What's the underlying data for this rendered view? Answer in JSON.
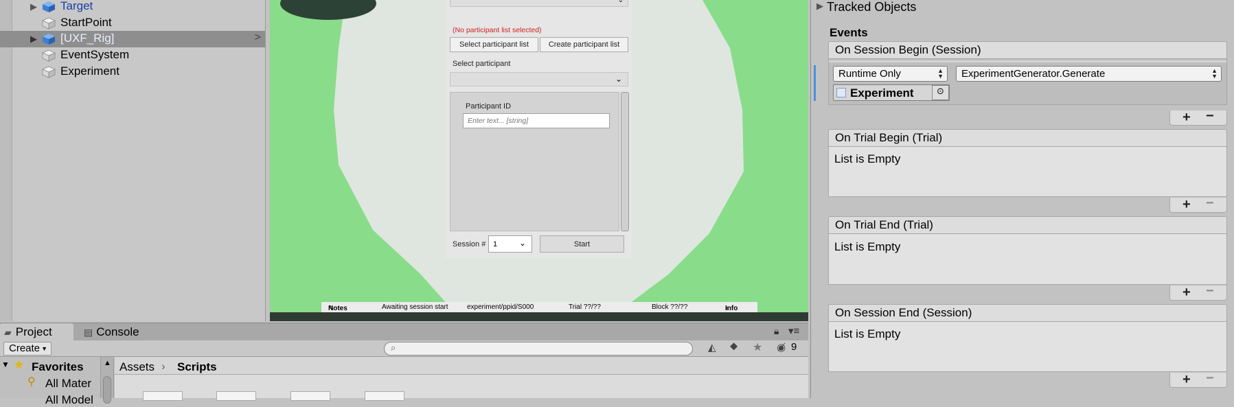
{
  "hierarchy": {
    "items": [
      {
        "label": "Target"
      },
      {
        "label": "StartPoint"
      },
      {
        "label": "[UXF_Rig]"
      },
      {
        "label": "EventSystem"
      },
      {
        "label": "Experiment"
      }
    ]
  },
  "game": {
    "no_list_warning": "(No participant list selected)",
    "select_list_button": "Select participant list",
    "create_list_button": "Create participant list",
    "select_participant_label": "Select participant",
    "participant_id_label": "Participant ID",
    "participant_id_placeholder": "Enter text... [string]",
    "session_label": "Session #",
    "session_value": "1",
    "start_button": "Start",
    "status": {
      "notes": "Notes",
      "session_status": "Awaiting session start",
      "path": "experiment/ppid/S000",
      "trial": "Trial ??/??",
      "block": "Block ??/??",
      "info": "Info"
    }
  },
  "project": {
    "tabs": {
      "project": "Project",
      "console": "Console"
    },
    "create_label": "Create",
    "hidden_count": "9",
    "favorites_label": "Favorites",
    "favorites_items": [
      "All Mater",
      "All Model"
    ],
    "breadcrumb": {
      "root": "Assets",
      "current": "Scripts"
    }
  },
  "inspector": {
    "tracked_objects": "Tracked Objects",
    "events_label": "Events",
    "events": [
      {
        "title": "On Session Begin (Session)",
        "runtime": "Runtime Only",
        "function": "ExperimentGenerator.Generate",
        "object": "Experiment"
      },
      {
        "title": "On Trial Begin (Trial)",
        "empty": "List is Empty"
      },
      {
        "title": "On Trial End (Trial)",
        "empty": "List is Empty"
      },
      {
        "title": "On Session End (Session)",
        "empty": "List is Empty"
      }
    ],
    "plus": "+",
    "minus": "−"
  },
  "colors": {
    "game_green": "#89dc8a",
    "ring_light": "#dfe6e0",
    "prefab_blue": "#1a3fa8",
    "warning_red": "#d32020"
  }
}
